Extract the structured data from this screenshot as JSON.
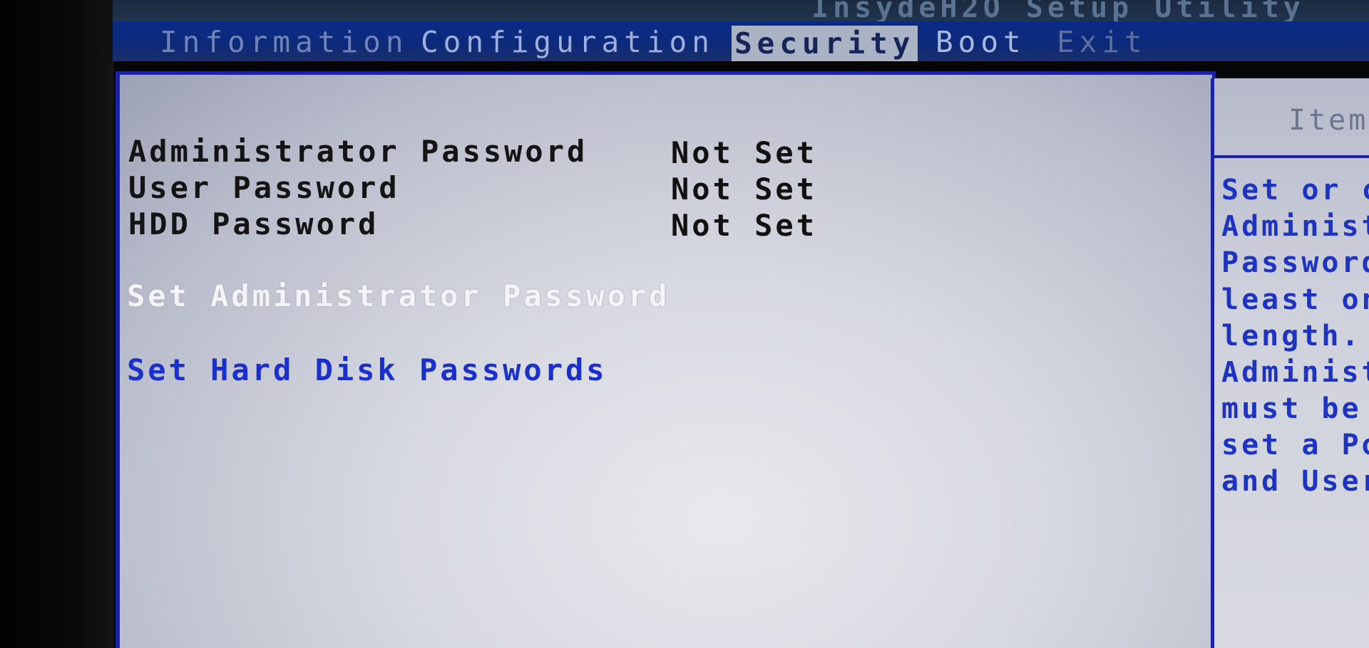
{
  "app": {
    "title": "InsydeH2O Setup Utility"
  },
  "menu": {
    "tabs": [
      {
        "label": "Information"
      },
      {
        "label": "Configuration"
      },
      {
        "label": "Security",
        "selected": true
      },
      {
        "label": "Boot"
      },
      {
        "label": "Exit"
      }
    ]
  },
  "security": {
    "status_rows": [
      {
        "label": "Administrator Password",
        "value": "Not Set"
      },
      {
        "label": "User Password",
        "value": "Not Set"
      },
      {
        "label": "HDD Password",
        "value": "Not Set"
      }
    ],
    "options": [
      {
        "label": "Set Administrator Password",
        "highlighted": true
      },
      {
        "label": "Set Hard Disk Passwords",
        "highlighted": false
      }
    ]
  },
  "help": {
    "title": "Item",
    "lines": [
      "Set or c",
      "Administ",
      "Password",
      "least on",
      "length.",
      "Administ",
      "must be",
      "set a Po",
      "and User"
    ]
  },
  "colors": {
    "menu_bar": "#0d2a7a",
    "frame_blue": "#1a22a8",
    "link_blue": "#1a2fd0",
    "panel_gray": "#d6d8e0",
    "selected_tab_bg": "#aab3c4"
  }
}
